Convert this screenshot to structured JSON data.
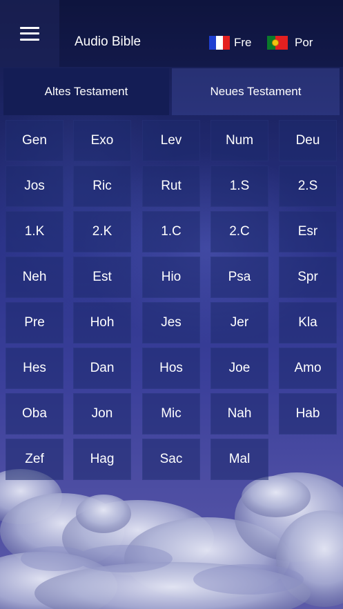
{
  "header": {
    "title": "Audio Bible",
    "menu_icon": "hamburger-menu-icon",
    "languages": [
      {
        "label": "Fre",
        "flag": "france-flag-icon"
      },
      {
        "label": "Por",
        "flag": "portugal-flag-icon"
      }
    ]
  },
  "tabs": [
    {
      "label": "Altes Testament",
      "selected": true
    },
    {
      "label": "Neues Testament",
      "selected": false
    }
  ],
  "books": [
    "Gen",
    "Exo",
    "Lev",
    "Num",
    "Deu",
    "Jos",
    "Ric",
    "Rut",
    "1.S",
    "2.S",
    "1.K",
    "2.K",
    "1.C",
    "2.C",
    "Esr",
    "Neh",
    "Est",
    "Hio",
    "Psa",
    "Spr",
    "Pre",
    "Hoh",
    "Jes",
    "Jer",
    "Kla",
    "Hes",
    "Dan",
    "Hos",
    "Joe",
    "Amo",
    "Oba",
    "Jon",
    "Mic",
    "Nah",
    "Hab",
    "Zef",
    "Hag",
    "Sac",
    "Mal"
  ],
  "colors": {
    "selected_tab": "#141d55",
    "tile": "#1e2a6e",
    "background_top": "#121845",
    "background_bottom": "#5c5aa8"
  }
}
